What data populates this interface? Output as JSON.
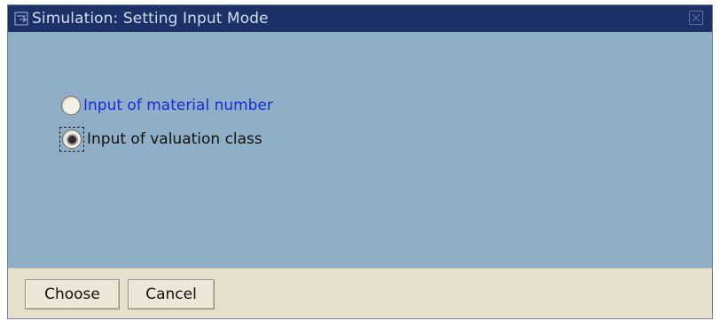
{
  "window": {
    "title": "Simulation: Setting Input Mode",
    "title_icon": "dialog-icon",
    "close_icon": "close-icon"
  },
  "options": {
    "material_number_label": "Input of material number",
    "valuation_class_label": "Input of valuation class",
    "selected": "valuation_class"
  },
  "buttons": {
    "choose_label": "Choose",
    "cancel_label": "Cancel"
  },
  "colors": {
    "titlebar": "#1c3168",
    "content_bg": "#8fafc6",
    "footer_bg": "#e6dfcc",
    "link_blue": "#1b2bdc"
  }
}
